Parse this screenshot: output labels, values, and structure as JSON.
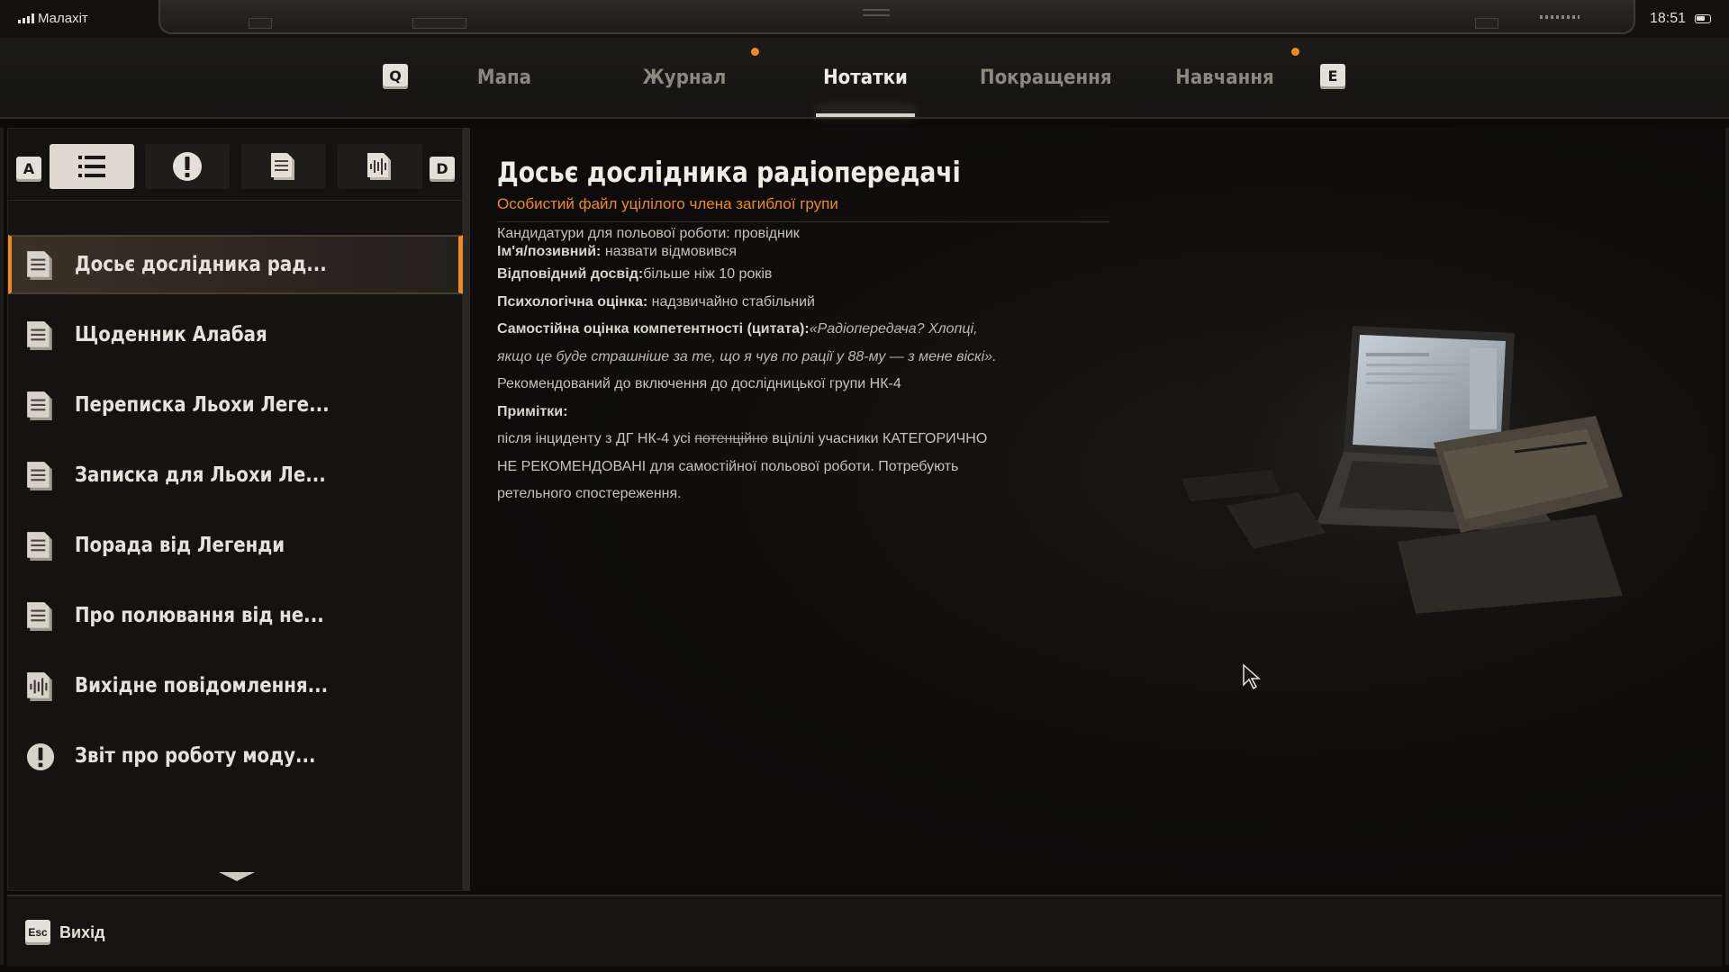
{
  "status_bar": {
    "carrier": "Малахіт",
    "time": "18:51"
  },
  "tabs": {
    "prev_key": "Q",
    "next_key": "E",
    "items": [
      {
        "label": "Мапа",
        "active": false,
        "notification": false
      },
      {
        "label": "Журнал",
        "active": false,
        "notification": true
      },
      {
        "label": "Нотатки",
        "active": true,
        "notification": false
      },
      {
        "label": "Покращення",
        "active": false,
        "notification": false
      },
      {
        "label": "Навчання",
        "active": false,
        "notification": true
      }
    ]
  },
  "filters": {
    "prev_key": "A",
    "next_key": "D",
    "items": [
      {
        "icon": "list-icon",
        "active": true
      },
      {
        "icon": "exclamation-icon",
        "active": false
      },
      {
        "icon": "document-icon",
        "active": false
      },
      {
        "icon": "audio-note-icon",
        "active": false
      }
    ]
  },
  "notes_list": [
    {
      "label": "Досьє дослідника рад...",
      "icon": "document-icon",
      "active": true
    },
    {
      "label": "Щоденник Алабая",
      "icon": "document-icon",
      "active": false
    },
    {
      "label": "Переписка Льохи Леге...",
      "icon": "document-icon",
      "active": false
    },
    {
      "label": "Записка для Льохи Ле...",
      "icon": "document-icon",
      "active": false
    },
    {
      "label": "Порада від Легенди",
      "icon": "document-icon",
      "active": false
    },
    {
      "label": "Про полювання від не...",
      "icon": "document-icon",
      "active": false
    },
    {
      "label": "Вихідне повідомлення...",
      "icon": "audio-note-icon",
      "active": false
    },
    {
      "label": "Звіт про роботу моду...",
      "icon": "exclamation-icon",
      "active": false
    }
  ],
  "document": {
    "title": "Досьє дослідника радіопередачі",
    "subtitle": "Особистий файл уцілілого члена загиблої групи",
    "line1": "Кандидатури для польової роботи: провідник",
    "name_label": "Ім'я/позивний:",
    "name_value": " назвати відмовився",
    "experience_label": "Відповідний досвід:",
    "experience_value": "більше ніж 10 років",
    "psych_label": "Психологічна оцінка:",
    "psych_value": " надзвичайно стабільний",
    "self_label": "Самостійна оцінка компетентності (цитата):",
    "self_quote_1": "«Радіопередача? Хлопці,",
    "self_quote_2": "якщо це буде страшніше за те, що я чув по рації у 88-му — з мене віскі».",
    "recommendation": "Рекомендований до включення до дослідницької групи НК-4",
    "notes_label": "Примітки:",
    "notes_1a": "після інциденту з ДГ НК-4 усі ",
    "notes_1_struck": "потенційно",
    "notes_1b": " вцілілі учасники КАТЕГОРИЧНО",
    "notes_2": "НЕ РЕКОМЕНДОВАНІ для самостійної польової роботи. Потребують",
    "notes_3": "ретельного спостереження."
  },
  "footer": {
    "exit_key": "Esc",
    "exit_label": "Вихід"
  },
  "colors": {
    "accent": "#f08a1c",
    "active_filter_bg": "#dedad2",
    "text": "#e6e2db"
  }
}
